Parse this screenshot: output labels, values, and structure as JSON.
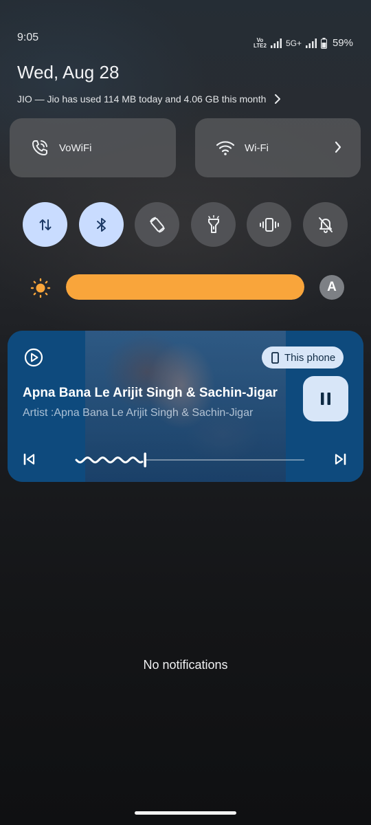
{
  "status_bar": {
    "time": "9:05",
    "volte_label": "Vó LTE2",
    "network": "5G+",
    "battery": "59%"
  },
  "header": {
    "date": "Wed, Aug 28",
    "data_usage": "JIO — Jio has used 114 MB today and 4.06 GB this month"
  },
  "tiles": {
    "vowifi": {
      "label": "VoWiFi",
      "icon": "wifi-calling-icon"
    },
    "wifi": {
      "label": "Wi-Fi",
      "icon": "wifi-icon"
    }
  },
  "toggles": [
    {
      "name": "mobile-data",
      "icon": "data-arrows-icon",
      "on": true
    },
    {
      "name": "bluetooth",
      "icon": "bluetooth-icon",
      "on": true
    },
    {
      "name": "auto-rotate",
      "icon": "rotate-icon",
      "on": false
    },
    {
      "name": "flashlight",
      "icon": "flashlight-icon",
      "on": false
    },
    {
      "name": "vibrate",
      "icon": "vibrate-icon",
      "on": false
    },
    {
      "name": "do-not-disturb",
      "icon": "bell-off-icon",
      "on": false
    }
  ],
  "brightness": {
    "level": 1.0,
    "auto_label": "A",
    "color": "#f9a53b"
  },
  "media": {
    "device_label": "This phone",
    "title": "Apna Bana Le Arijit Singh & Sachin-Jigar",
    "artist": "Artist :Apna Bana Le Arijit Singh & Sachin-Jigar",
    "progress": 0.33,
    "accent": "#0e4a7d"
  },
  "notifications": {
    "empty_text": "No notifications"
  }
}
